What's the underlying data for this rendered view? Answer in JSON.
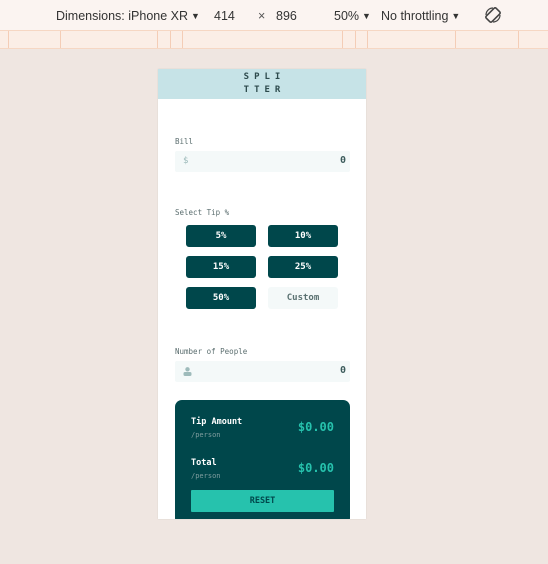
{
  "devtools": {
    "dimensions_label": "Dimensions: iPhone XR",
    "width": "414",
    "times": "×",
    "height": "896",
    "zoom": "50%",
    "throttling": "No throttling",
    "rotate_icon": "rotate-icon"
  },
  "app": {
    "title_line1": "SPLI",
    "title_line2": "TTER",
    "bill": {
      "label": "Bill",
      "icon": "$",
      "value": "0"
    },
    "select_tip_label": "Select Tip %",
    "tips": [
      "5%",
      "10%",
      "15%",
      "25%",
      "50%"
    ],
    "custom_placeholder": "Custom",
    "people": {
      "label": "Number of People",
      "icon": "person-icon",
      "value": "0"
    },
    "results": {
      "tip_amount_label": "Tip Amount",
      "tip_per": "/person",
      "tip_value": "$0.00",
      "total_label": "Total",
      "total_per": "/person",
      "total_value": "$0.00",
      "reset_label": "RESET"
    },
    "colors": {
      "dark_cyan": "#00474b",
      "strong_cyan": "#26c2ad",
      "header_bg": "#c6e3e7",
      "input_bg": "#f4f9f9",
      "page_bg": "#efe6e1"
    }
  }
}
